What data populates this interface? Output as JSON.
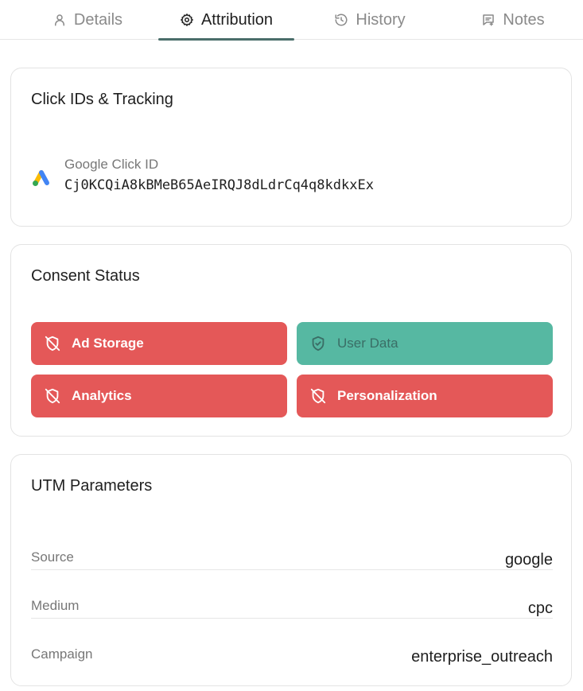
{
  "tabs": [
    {
      "label": "Details",
      "icon": "user-icon",
      "active": false
    },
    {
      "label": "Attribution",
      "icon": "gear-icon",
      "active": true
    },
    {
      "label": "History",
      "icon": "history-icon",
      "active": false
    },
    {
      "label": "Notes",
      "icon": "notes-icon",
      "active": false
    }
  ],
  "click_ids": {
    "title": "Click IDs & Tracking",
    "gclid_label": "Google Click ID",
    "gclid_value": "Cj0KCQiA8kBMeB65AeIRQJ8dLdrCq4q8kdkxEx",
    "logo_icon": "google-ads-logo"
  },
  "consent": {
    "title": "Consent Status",
    "items": [
      {
        "label": "Ad Storage",
        "state": "denied",
        "icon": "shield-off-icon"
      },
      {
        "label": "User Data",
        "state": "granted",
        "icon": "shield-check-icon"
      },
      {
        "label": "Analytics",
        "state": "denied",
        "icon": "shield-off-icon"
      },
      {
        "label": "Personalization",
        "state": "denied",
        "icon": "shield-off-icon"
      }
    ],
    "colors": {
      "denied": "#e45858",
      "granted": "#56b8a2"
    }
  },
  "utm": {
    "title": "UTM Parameters",
    "rows": [
      {
        "key": "Source",
        "value": "google"
      },
      {
        "key": "Medium",
        "value": "cpc"
      },
      {
        "key": "Campaign",
        "value": "enterprise_outreach"
      }
    ]
  },
  "colors": {
    "accent": "#4a6e6a",
    "border": "#e3e3e3"
  }
}
